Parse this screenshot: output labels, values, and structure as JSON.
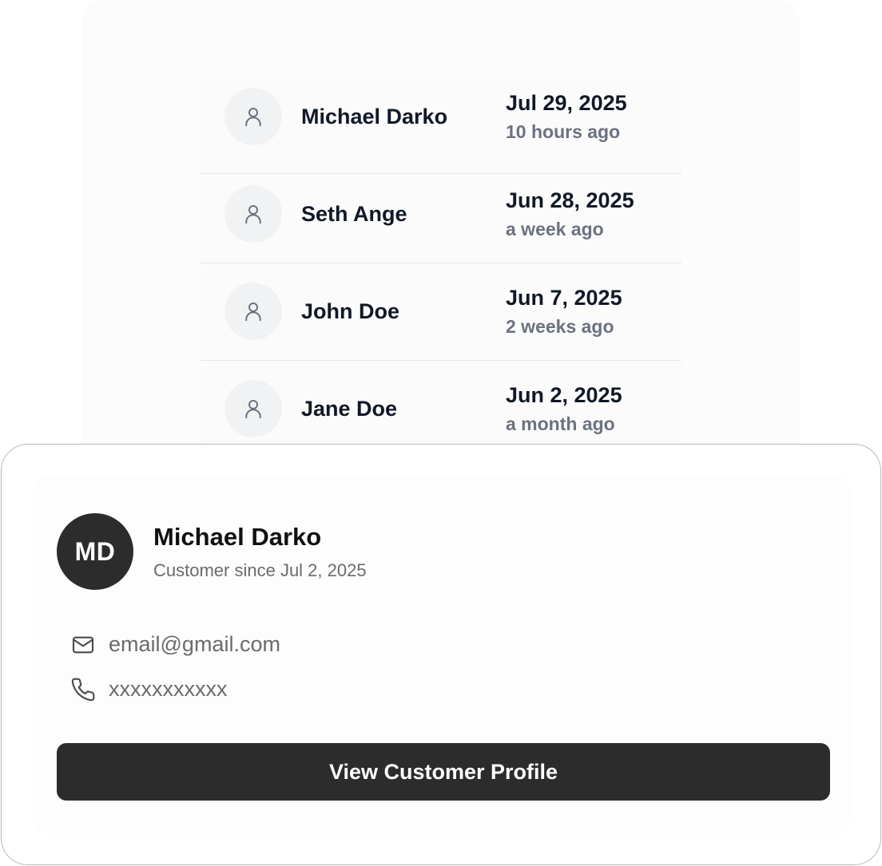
{
  "recent_customers": [
    {
      "name": "Michael Darko",
      "date": "Jul 29, 2025",
      "ago": "10 hours ago"
    },
    {
      "name": "Seth Ange",
      "date": "Jun 28, 2025",
      "ago": "a week ago"
    },
    {
      "name": "John Doe",
      "date": "Jun 7, 2025",
      "ago": "2 weeks ago"
    },
    {
      "name": "Jane Doe",
      "date": "Jun 2, 2025",
      "ago": "a month ago"
    }
  ],
  "profile_card": {
    "initials": "MD",
    "name": "Michael Darko",
    "since": "Customer since Jul 2, 2025",
    "email": "email@gmail.com",
    "phone": "xxxxxxxxxxx",
    "button_label": "View Customer Profile",
    "email_icon": "mail-icon",
    "phone_icon": "phone-icon"
  },
  "colors": {
    "dark": "#2c2c2c",
    "muted_text": "#6b7280",
    "avatar_bg": "#f1f2f4"
  }
}
